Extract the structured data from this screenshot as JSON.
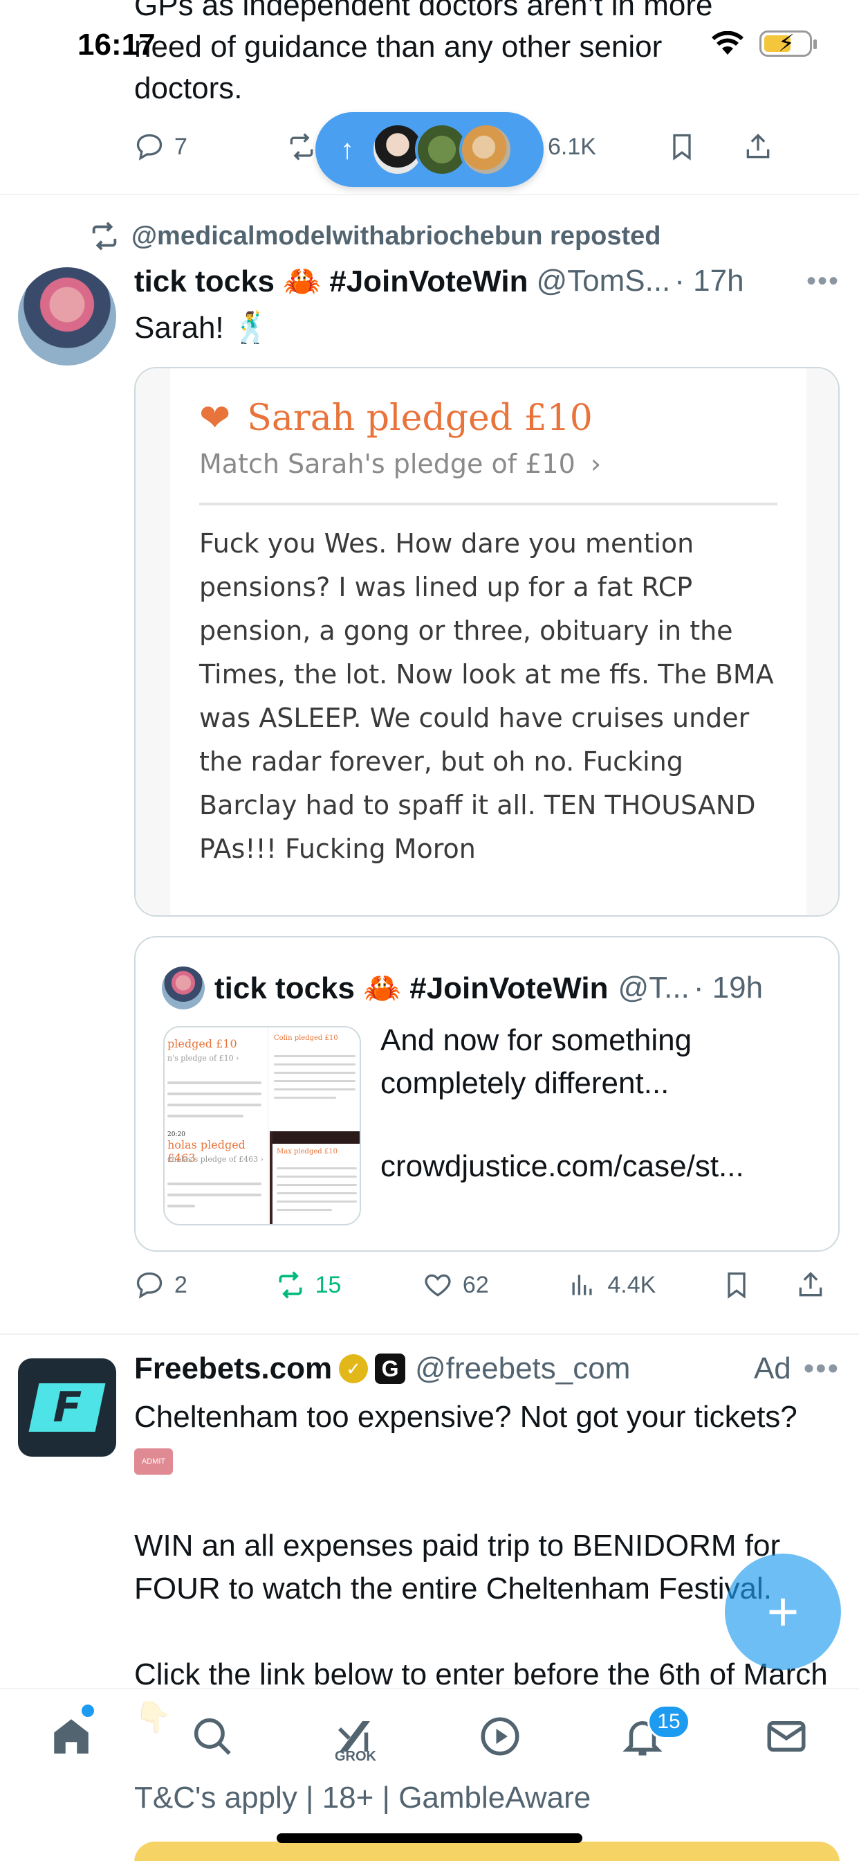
{
  "status_bar": {
    "time": "16:17"
  },
  "top_tweet": {
    "text_lines": [
      "GPs as independent doctors aren’t in more",
      "need of guidance than any other senior",
      "doctors."
    ],
    "replies": "7",
    "views": "6.1K"
  },
  "repost": {
    "reposted_by": "@medicalmodelwithabriochebun reposted",
    "author_name": "tick tocks 🦀 #JoinVoteWin",
    "handle": "@TomS...",
    "time": "· 17h",
    "body": "Sarah! 🕺",
    "pledge_card": {
      "title": "Sarah pledged £10",
      "subtitle": "Match Sarah's pledge of £10",
      "chevron": "›",
      "text": "Fuck you Wes. How dare you mention pensions? I was lined up for a fat RCP pension, a gong or three, obituary in the Times, the lot. Now look at me ffs. The BMA was ASLEEP. We could have cruises under the radar forever, but oh no. Fucking Barclay had to spaff it all. TEN THOUSAND PAs!!! Fucking Moron"
    },
    "quote": {
      "author_name": "tick tocks 🦀 #JoinVoteWin",
      "handle": "@T...",
      "time": "· 19h",
      "text": "And now for something completely different...",
      "link": "crowdjustice.com/case/st...",
      "thumb": {
        "t1": "pledged £10",
        "t2": "n's pledge of £10 ›",
        "t3": "holas pledged £463",
        "t4": "cholas's pledge of £463 ›",
        "t5": "Colin pledged £10",
        "t6": "Max pledged £10",
        "t7": "20:20"
      }
    },
    "replies": "2",
    "reposts": "15",
    "likes": "62",
    "views": "4.4K"
  },
  "ad": {
    "name": "Freebets.com",
    "affiliate": "G",
    "handle": "@freebets_com",
    "label": "Ad",
    "avatar_letter": "F",
    "line1": "Cheltenham too expensive? Not got your tickets?",
    "ticket_text": "ADMIT ONE",
    "line2": "WIN an all expenses paid trip to BENIDORM for FOUR to watch the entire Cheltenham Festival.",
    "line3": "Click the link below to enter before the 6th of March 👇",
    "footer": "T&C's apply | 18+ | GambleAware"
  },
  "fab_label": "+",
  "nav": {
    "grok_label": "GROK",
    "notifications_count": "15"
  },
  "colors": {
    "accent": "#1d9bf0",
    "retweet_green": "#00ba7c",
    "pledge_orange": "#e8743b"
  },
  "icons": [
    "reply-icon",
    "retweet-icon",
    "views-icon",
    "bookmark-icon",
    "share-icon",
    "heart-icon",
    "home-icon",
    "search-icon",
    "grok-icon",
    "play-icon",
    "bell-icon",
    "mail-icon"
  ]
}
